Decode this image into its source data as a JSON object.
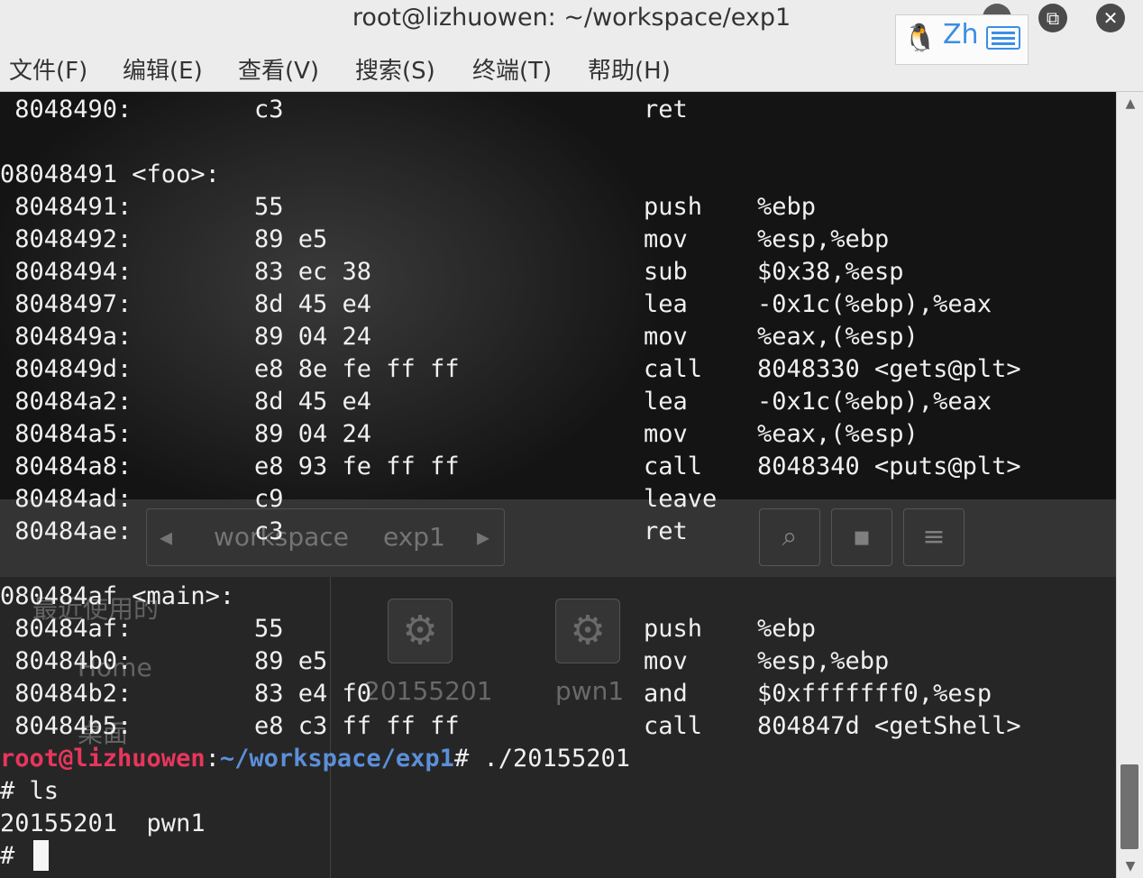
{
  "window": {
    "title": "root@lizhuowen: ~/workspace/exp1"
  },
  "ime": {
    "label": "Zh",
    "penguin_icon": "penguin-icon",
    "keyboard_icon": "keyboard-icon"
  },
  "controls": {
    "maximize_glyph": "⧉",
    "close_glyph": "✕"
  },
  "menu": [
    "文件(F)",
    "编辑(E)",
    "查看(V)",
    "搜索(S)",
    "终端(T)",
    "帮助(H)"
  ],
  "background_window": {
    "path_segments": [
      "workspace",
      "exp1"
    ],
    "sidebar": [
      "最近使用的",
      "Home",
      "桌面"
    ],
    "files": [
      "20155201",
      "pwn1"
    ]
  },
  "disassembly": [
    {
      "addr": " 8048490:",
      "bytes": "c3",
      "op": "ret",
      "args": ""
    },
    {
      "addr": "",
      "bytes": "",
      "op": "",
      "args": ""
    },
    {
      "label": "08048491 <foo>:"
    },
    {
      "addr": " 8048491:",
      "bytes": "55",
      "op": "push",
      "args": "%ebp"
    },
    {
      "addr": " 8048492:",
      "bytes": "89 e5",
      "op": "mov",
      "args": "%esp,%ebp"
    },
    {
      "addr": " 8048494:",
      "bytes": "83 ec 38",
      "op": "sub",
      "args": "$0x38,%esp"
    },
    {
      "addr": " 8048497:",
      "bytes": "8d 45 e4",
      "op": "lea",
      "args": "-0x1c(%ebp),%eax"
    },
    {
      "addr": " 804849a:",
      "bytes": "89 04 24",
      "op": "mov",
      "args": "%eax,(%esp)"
    },
    {
      "addr": " 804849d:",
      "bytes": "e8 8e fe ff ff",
      "op": "call",
      "args": "8048330 <gets@plt>"
    },
    {
      "addr": " 80484a2:",
      "bytes": "8d 45 e4",
      "op": "lea",
      "args": "-0x1c(%ebp),%eax"
    },
    {
      "addr": " 80484a5:",
      "bytes": "89 04 24",
      "op": "mov",
      "args": "%eax,(%esp)"
    },
    {
      "addr": " 80484a8:",
      "bytes": "e8 93 fe ff ff",
      "op": "call",
      "args": "8048340 <puts@plt>"
    },
    {
      "addr": " 80484ad:",
      "bytes": "c9",
      "op": "leave",
      "args": ""
    },
    {
      "addr": " 80484ae:",
      "bytes": "c3",
      "op": "ret",
      "args": ""
    },
    {
      "addr": "",
      "bytes": "",
      "op": "",
      "args": ""
    },
    {
      "label": "080484af <main>:"
    },
    {
      "addr": " 80484af:",
      "bytes": "55",
      "op": "push",
      "args": "%ebp"
    },
    {
      "addr": " 80484b0:",
      "bytes": "89 e5",
      "op": "mov",
      "args": "%esp,%ebp"
    },
    {
      "addr": " 80484b2:",
      "bytes": "83 e4 f0",
      "op": "and",
      "args": "$0xfffffff0,%esp"
    },
    {
      "addr": " 80484b5:",
      "bytes": "e8 c3 ff ff ff",
      "op": "call",
      "args": "804847d <getShell>"
    }
  ],
  "prompt": {
    "user_host": "root@lizhuowen",
    "sep": ":",
    "path": "~/workspace/exp1",
    "symbol": "# ",
    "command": "./20155201"
  },
  "shell": [
    {
      "text": "# ls"
    },
    {
      "text": "20155201  pwn1"
    },
    {
      "text": "# "
    }
  ]
}
